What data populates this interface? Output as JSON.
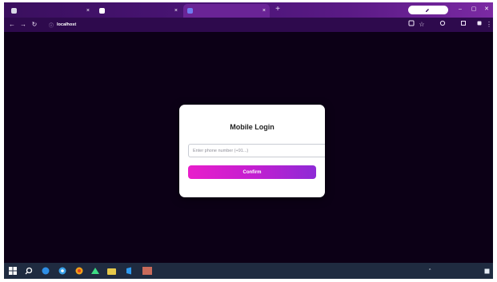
{
  "browser": {
    "tabs": [
      {
        "title": "",
        "favicon": "app-tab-icon",
        "color": "#d9d9e6",
        "active": false
      },
      {
        "title": "",
        "favicon": "app-tab-icon",
        "color": "#ffffff",
        "active": false
      },
      {
        "title": "",
        "favicon": "page-tab-icon",
        "color": "#6f7cf0",
        "active": true
      }
    ],
    "new_tab_glyph": "+",
    "profile_button": {
      "icon": "edit-icon",
      "label": ""
    },
    "window_controls": {
      "minimize": "–",
      "maximize": "▢",
      "close": "✕"
    },
    "toolbar": {
      "back": "←",
      "forward": "→",
      "reload": "↻",
      "url_host": "localhost",
      "url_path": ""
    }
  },
  "page": {
    "background": "#0c0016",
    "card": {
      "title": "Mobile Login",
      "phone_placeholder": "Enter phone number (+91...)",
      "phone_value": "",
      "confirm_label": "Confirm",
      "accent_start": "#e81ecb",
      "accent_end": "#8e2ad6"
    }
  },
  "taskbar": {
    "color": "#1f2b40",
    "pinned_apps": [
      "windows-start-icon",
      "search-icon",
      "edge-icon",
      "chrome-icon",
      "firefox-icon",
      "android-studio-icon",
      "file-explorer-icon",
      "vscode-icon",
      "image-viewer-icon"
    ],
    "tray_chevron": "^",
    "tray_lang": "",
    "clock_time": "",
    "clock_date": ""
  }
}
